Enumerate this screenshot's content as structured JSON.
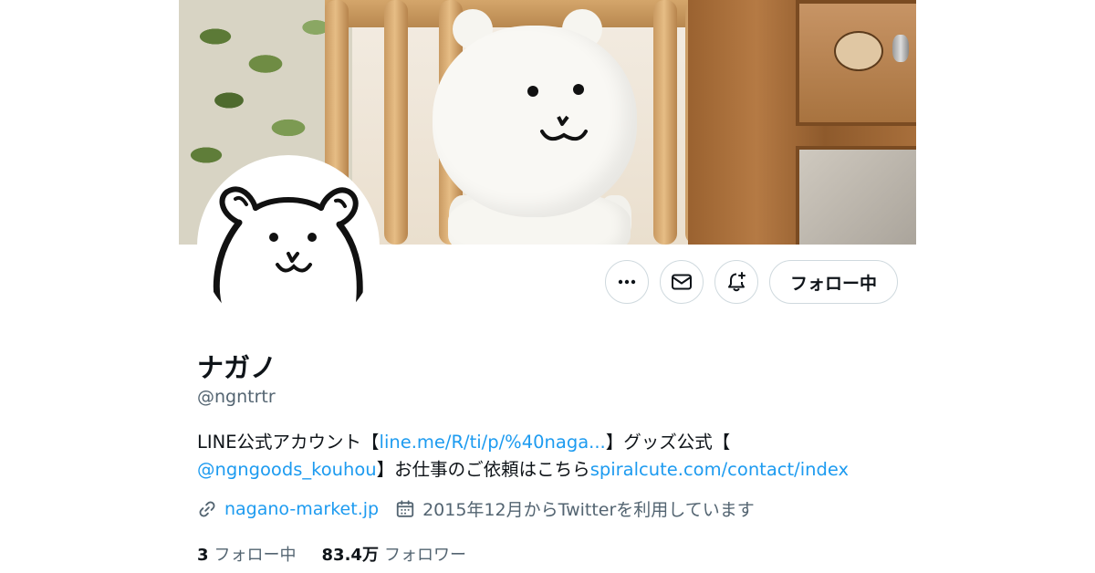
{
  "profile": {
    "display_name": "ナガノ",
    "handle": "@ngntrtr",
    "bio": {
      "line1_prefix": "LINE公式アカウント【",
      "line1_link": "line.me/R/ti/p/%40naga...",
      "line1_suffix": "】グッズ公式【",
      "line2_mention": "@ngngoods_kouhou",
      "line2_text": "】お仕事のご依頼はこちら",
      "line2_link": "spiralcute.com/contact/index"
    },
    "website": "nagano-market.jp",
    "joined": "2015年12月からTwitterを利用しています",
    "following_count": "3",
    "following_label": "フォロー中",
    "followers_count": "83.4万",
    "followers_label": "フォロワー"
  },
  "actions": {
    "more_icon": "more-icon",
    "message_icon": "mail-icon",
    "notify_icon": "bell-plus-icon",
    "follow_label": "フォロー中"
  },
  "colors": {
    "link": "#1d9bf0",
    "secondary_text": "#536471",
    "border": "#cfd9de"
  }
}
